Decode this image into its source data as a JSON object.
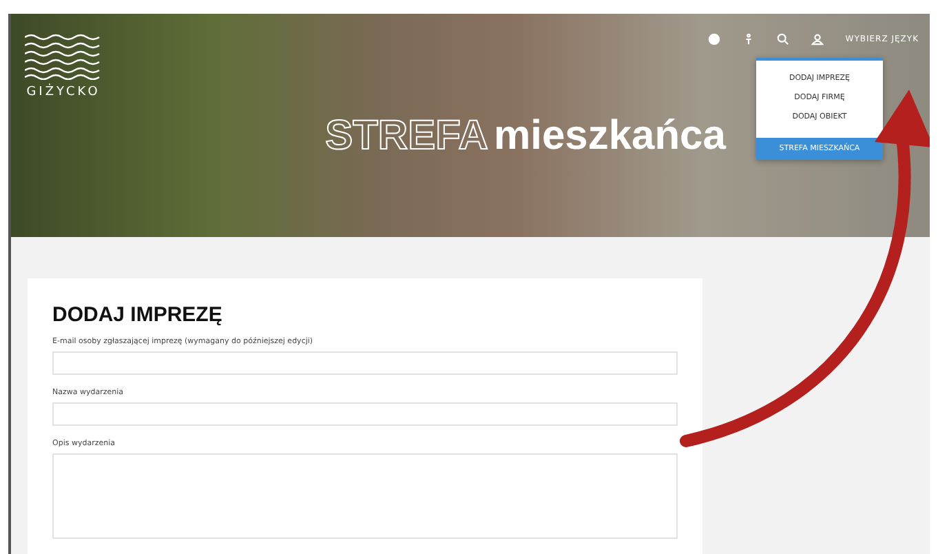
{
  "logo": {
    "text": "GIŻYCKO"
  },
  "top_nav": {
    "language": "WYBIERZ JĘZYK"
  },
  "menu": {
    "items": [
      {
        "label": "DODAJ IMPREZĘ"
      },
      {
        "label": "DODAJ FIRMĘ"
      },
      {
        "label": "DODAJ OBIEKT"
      }
    ],
    "footer": "STREFA MIESZKAŃCA"
  },
  "hero": {
    "title_outline": "STREFA",
    "title_bold": "mieszkańca"
  },
  "form": {
    "title": "DODAJ IMPREZĘ",
    "fields": [
      {
        "kind": "input",
        "label": "E-mail osoby zgłaszającej imprezę (wymagany do późniejszej edycji)"
      },
      {
        "kind": "input",
        "label": "Nazwa wydarzenia"
      },
      {
        "kind": "textarea",
        "label": "Opis wydarzenia"
      }
    ]
  }
}
